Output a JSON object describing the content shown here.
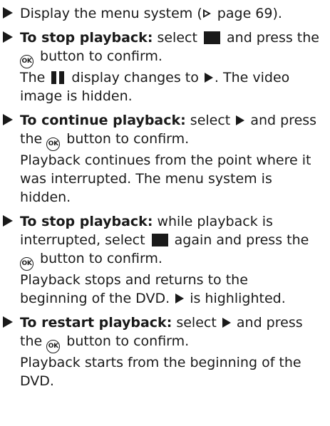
{
  "items": [
    {
      "lines": [
        {
          "segments": [
            {
              "text": "Display the menu system ("
            },
            {
              "icon": "page-reference-icon"
            },
            {
              "text": " page 69)."
            }
          ]
        }
      ]
    },
    {
      "lines": [
        {
          "segments": [
            {
              "text": "To stop playback:",
              "bold": true
            },
            {
              "text": " select "
            },
            {
              "icon": "stop-icon"
            },
            {
              "text": " and press the"
            }
          ]
        },
        {
          "segments": [
            {
              "icon": "ok-button-icon",
              "label": "OK"
            },
            {
              "text": " button to confirm."
            }
          ]
        },
        {
          "segments": [
            {
              "text": "The "
            },
            {
              "icon": "pause-icon"
            },
            {
              "text": " display changes to "
            },
            {
              "icon": "play-icon"
            },
            {
              "text": ". The video"
            }
          ]
        },
        {
          "segments": [
            {
              "text": "image is hidden."
            }
          ]
        }
      ]
    },
    {
      "lines": [
        {
          "segments": [
            {
              "text": "To continue playback:",
              "bold": true
            },
            {
              "text": " select "
            },
            {
              "icon": "play-icon"
            },
            {
              "text": " and press"
            }
          ]
        },
        {
          "segments": [
            {
              "text": "the "
            },
            {
              "icon": "ok-button-icon",
              "label": "OK"
            },
            {
              "text": " button to confirm."
            }
          ]
        },
        {
          "segments": [
            {
              "text": "Playback continues from the point where it"
            }
          ]
        },
        {
          "segments": [
            {
              "text": "was interrupted. The menu system is"
            }
          ]
        },
        {
          "segments": [
            {
              "text": "hidden."
            }
          ]
        }
      ]
    },
    {
      "lines": [
        {
          "segments": [
            {
              "text": "To stop playback:",
              "bold": true
            },
            {
              "text": " while playback is"
            }
          ]
        },
        {
          "segments": [
            {
              "text": "interrupted, select "
            },
            {
              "icon": "stop-icon"
            },
            {
              "text": " again and press the"
            }
          ]
        },
        {
          "segments": [
            {
              "icon": "ok-button-icon",
              "label": "OK"
            },
            {
              "text": " button to confirm."
            }
          ]
        },
        {
          "segments": [
            {
              "text": "Playback stops and returns to the"
            }
          ]
        },
        {
          "segments": [
            {
              "text": "beginning of the DVD. "
            },
            {
              "icon": "play-icon"
            },
            {
              "text": " is highlighted."
            }
          ]
        }
      ]
    },
    {
      "lines": [
        {
          "segments": [
            {
              "text": "To restart playback:",
              "bold": true
            },
            {
              "text": " select "
            },
            {
              "icon": "play-icon"
            },
            {
              "text": " and press"
            }
          ]
        },
        {
          "segments": [
            {
              "text": "the "
            },
            {
              "icon": "ok-button-icon",
              "label": "OK"
            },
            {
              "text": " button to confirm."
            }
          ]
        },
        {
          "segments": [
            {
              "text": "Playback starts from the beginning of the"
            }
          ]
        },
        {
          "segments": [
            {
              "text": "DVD."
            }
          ]
        }
      ]
    }
  ]
}
